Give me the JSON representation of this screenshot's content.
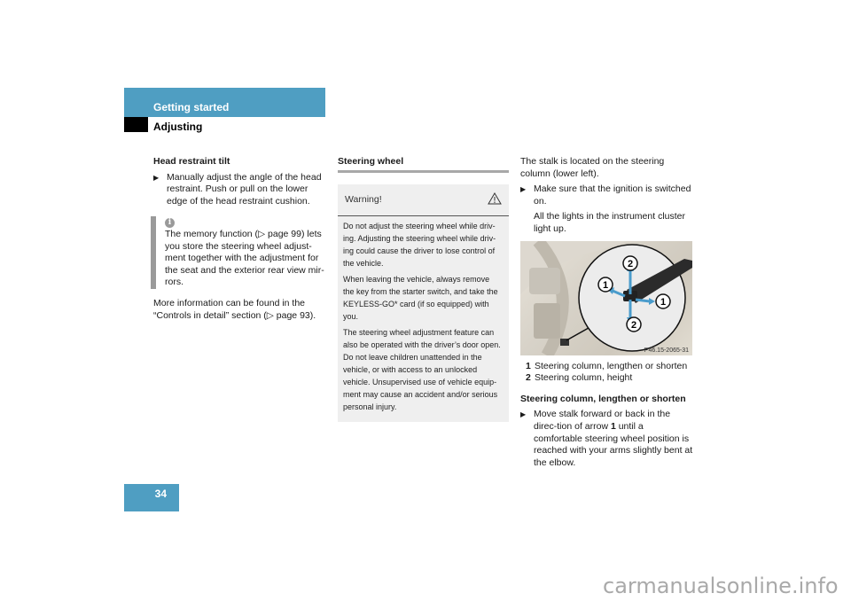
{
  "header": {
    "section": "Getting started",
    "subsection": "Adjusting"
  },
  "column1": {
    "heading": "Head restraint tilt",
    "bullet": "Manually adjust the angle of the head restraint. Push or pull on the lower edge of the head restraint cushion.",
    "info_icon": "info-icon",
    "info_text": "The memory function (▷ page 99) lets you store the steering wheel adjust-ment together with the adjustment for the seat and the exterior rear view mir-rors.",
    "more_info": "More information can be found in the “Controls in detail” section (▷ page 93)."
  },
  "column2": {
    "heading": "Steering wheel",
    "warning": {
      "title": "Warning!",
      "icon": "warning-triangle-icon",
      "paragraphs": [
        "Do not adjust the steering wheel while driv-ing. Adjusting the steering wheel while driv-ing could cause the driver to lose control of the vehicle.",
        "When leaving the vehicle, always remove the key from the starter switch, and take the KEYLESS-GO* card (if so equipped) with you.",
        "The steering wheel adjustment feature can also be operated with the driver’s door open. Do not leave children unattended in the vehicle, or with access to an unlocked vehicle. Unsupervised use of vehicle equip-ment may cause an accident and/or serious personal injury."
      ]
    }
  },
  "column3": {
    "intro": "The stalk is located on the steering column (lower left).",
    "bullet1": "Make sure that the ignition is switched on.",
    "bullet1_result": "All the lights in the instrument cluster light up.",
    "figure": {
      "code": "P46.15-2065-31",
      "callouts": [
        "1",
        "2",
        "1",
        "2"
      ]
    },
    "legend": [
      {
        "num": "1",
        "text": "Steering column, lengthen or shorten"
      },
      {
        "num": "2",
        "text": "Steering column, height"
      }
    ],
    "heading2": "Steering column, lengthen or shorten",
    "bullet2_pre": "Move stalk forward or back in the direc-tion of arrow ",
    "bullet2_num": "1",
    "bullet2_post": " until a comfortable steering wheel position is reached with your arms slightly bent at the elbow."
  },
  "page_number": "34",
  "watermark": "carmanualsonline.info",
  "colors": {
    "accent": "#4f9ec2",
    "arrow": "#4a9ccc"
  }
}
